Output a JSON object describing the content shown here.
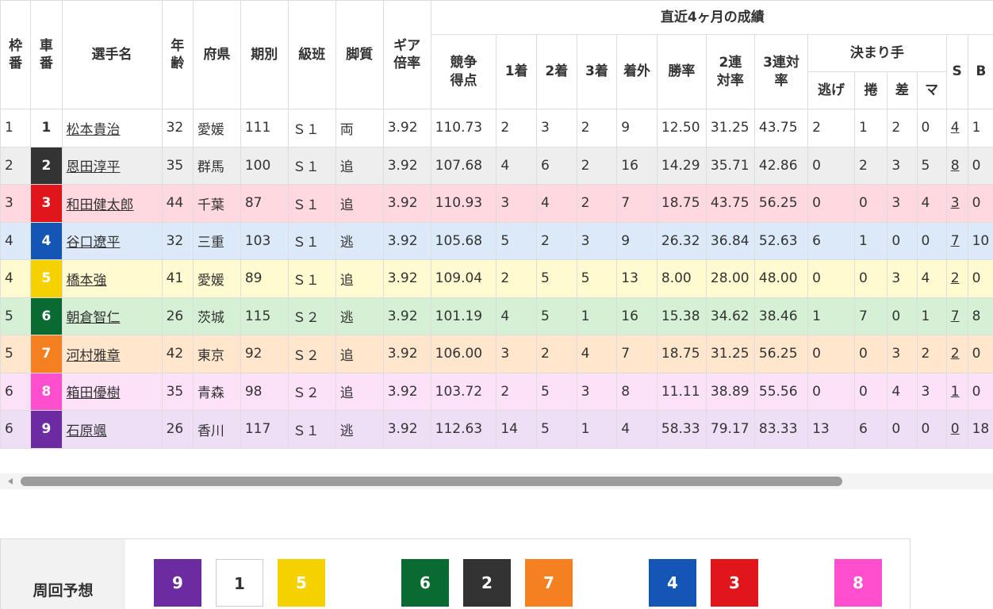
{
  "headers": {
    "waku": "枠番",
    "car": "車番",
    "name": "選手名",
    "age": "年齢",
    "pref": "府県",
    "term": "期別",
    "class": "級班",
    "style": "脚質",
    "gear": "ギア倍率",
    "recent": "直近4ヶ月の成績",
    "score": "競争得点",
    "first": "1着",
    "second": "2着",
    "third": "3着",
    "out": "着外",
    "win_rate": "勝率",
    "ren2": "2連対率",
    "ren3": "3連対率",
    "kimarite": "決まり手",
    "nige": "逃げ",
    "makuri": "捲",
    "sashi": "差",
    "mark": "マ",
    "s": "S",
    "b": "B"
  },
  "rows": [
    {
      "waku": "1",
      "car": "1",
      "name": "松本貴治",
      "age": "32",
      "pref": "愛媛",
      "term": "111",
      "class": "Ｓ１",
      "style": "両",
      "gear": "3.92",
      "score": "110.73",
      "first": "2",
      "second": "3",
      "third": "2",
      "out": "9",
      "win": "12.50",
      "r2": "31.25",
      "r3": "43.75",
      "nige": "2",
      "makuri": "1",
      "sashi": "2",
      "mark": "0",
      "s": "4",
      "b": "1"
    },
    {
      "waku": "2",
      "car": "2",
      "name": "恩田淳平",
      "age": "35",
      "pref": "群馬",
      "term": "100",
      "class": "Ｓ１",
      "style": "追",
      "gear": "3.92",
      "score": "107.68",
      "first": "4",
      "second": "6",
      "third": "2",
      "out": "16",
      "win": "14.29",
      "r2": "35.71",
      "r3": "42.86",
      "nige": "0",
      "makuri": "2",
      "sashi": "3",
      "mark": "5",
      "s": "8",
      "b": "0"
    },
    {
      "waku": "3",
      "car": "3",
      "name": "和田健太郎",
      "age": "44",
      "pref": "千葉",
      "term": "87",
      "class": "Ｓ１",
      "style": "追",
      "gear": "3.92",
      "score": "110.93",
      "first": "3",
      "second": "4",
      "third": "2",
      "out": "7",
      "win": "18.75",
      "r2": "43.75",
      "r3": "56.25",
      "nige": "0",
      "makuri": "0",
      "sashi": "3",
      "mark": "4",
      "s": "3",
      "b": "0"
    },
    {
      "waku": "4",
      "car": "4",
      "name": "谷口遼平",
      "age": "32",
      "pref": "三重",
      "term": "103",
      "class": "Ｓ１",
      "style": "逃",
      "gear": "3.92",
      "score": "105.68",
      "first": "5",
      "second": "2",
      "third": "3",
      "out": "9",
      "win": "26.32",
      "r2": "36.84",
      "r3": "52.63",
      "nige": "6",
      "makuri": "1",
      "sashi": "0",
      "mark": "0",
      "s": "7",
      "b": "10"
    },
    {
      "waku": "4",
      "car": "5",
      "name": "橋本強",
      "age": "41",
      "pref": "愛媛",
      "term": "89",
      "class": "Ｓ１",
      "style": "追",
      "gear": "3.92",
      "score": "109.04",
      "first": "2",
      "second": "5",
      "third": "5",
      "out": "13",
      "win": "8.00",
      "r2": "28.00",
      "r3": "48.00",
      "nige": "0",
      "makuri": "0",
      "sashi": "3",
      "mark": "4",
      "s": "2",
      "b": "0"
    },
    {
      "waku": "5",
      "car": "6",
      "name": "朝倉智仁",
      "age": "26",
      "pref": "茨城",
      "term": "115",
      "class": "Ｓ２",
      "style": "逃",
      "gear": "3.92",
      "score": "101.19",
      "first": "4",
      "second": "5",
      "third": "1",
      "out": "16",
      "win": "15.38",
      "r2": "34.62",
      "r3": "38.46",
      "nige": "1",
      "makuri": "7",
      "sashi": "0",
      "mark": "1",
      "s": "7",
      "b": "8"
    },
    {
      "waku": "5",
      "car": "7",
      "name": "河村雅章",
      "age": "42",
      "pref": "東京",
      "term": "92",
      "class": "Ｓ２",
      "style": "追",
      "gear": "3.92",
      "score": "106.00",
      "first": "3",
      "second": "2",
      "third": "4",
      "out": "7",
      "win": "18.75",
      "r2": "31.25",
      "r3": "56.25",
      "nige": "0",
      "makuri": "0",
      "sashi": "3",
      "mark": "2",
      "s": "2",
      "b": "0"
    },
    {
      "waku": "6",
      "car": "8",
      "name": "箱田優樹",
      "age": "35",
      "pref": "青森",
      "term": "98",
      "class": "Ｓ２",
      "style": "追",
      "gear": "3.92",
      "score": "103.72",
      "first": "2",
      "second": "5",
      "third": "3",
      "out": "8",
      "win": "11.11",
      "r2": "38.89",
      "r3": "55.56",
      "nige": "0",
      "makuri": "0",
      "sashi": "4",
      "mark": "3",
      "s": "1",
      "b": "0"
    },
    {
      "waku": "6",
      "car": "9",
      "name": "石原颯",
      "age": "26",
      "pref": "香川",
      "term": "117",
      "class": "Ｓ１",
      "style": "逃",
      "gear": "3.92",
      "score": "112.63",
      "first": "14",
      "second": "5",
      "third": "1",
      "out": "4",
      "win": "58.33",
      "r2": "79.17",
      "r3": "83.33",
      "nige": "13",
      "makuri": "6",
      "sashi": "0",
      "mark": "0",
      "s": "0",
      "b": "18"
    }
  ],
  "car_colors": {
    "1": {
      "bg": "#ffffff",
      "fg": "#333333",
      "row": "#ffffff"
    },
    "2": {
      "bg": "#333333",
      "fg": "#ffffff",
      "row": "#eeeeee"
    },
    "3": {
      "bg": "#e0161b",
      "fg": "#ffffff",
      "row": "#ffd9df"
    },
    "4": {
      "bg": "#1456b4",
      "fg": "#ffffff",
      "row": "#dbe9f8"
    },
    "5": {
      "bg": "#f5d100",
      "fg": "#ffffff",
      "row": "#fffad0"
    },
    "6": {
      "bg": "#0a6b32",
      "fg": "#ffffff",
      "row": "#d5f0d5"
    },
    "7": {
      "bg": "#f5801f",
      "fg": "#ffffff",
      "row": "#ffe6cc"
    },
    "8": {
      "bg": "#ff4fcf",
      "fg": "#ffffff",
      "row": "#fde1f8"
    },
    "9": {
      "bg": "#6c2ba0",
      "fg": "#ffffff",
      "row": "#eedff7"
    }
  },
  "prediction": {
    "label": "周回予想",
    "boxes": [
      "9",
      "1",
      "5",
      "6",
      "2",
      "7",
      "4",
      "3",
      "8"
    ]
  }
}
